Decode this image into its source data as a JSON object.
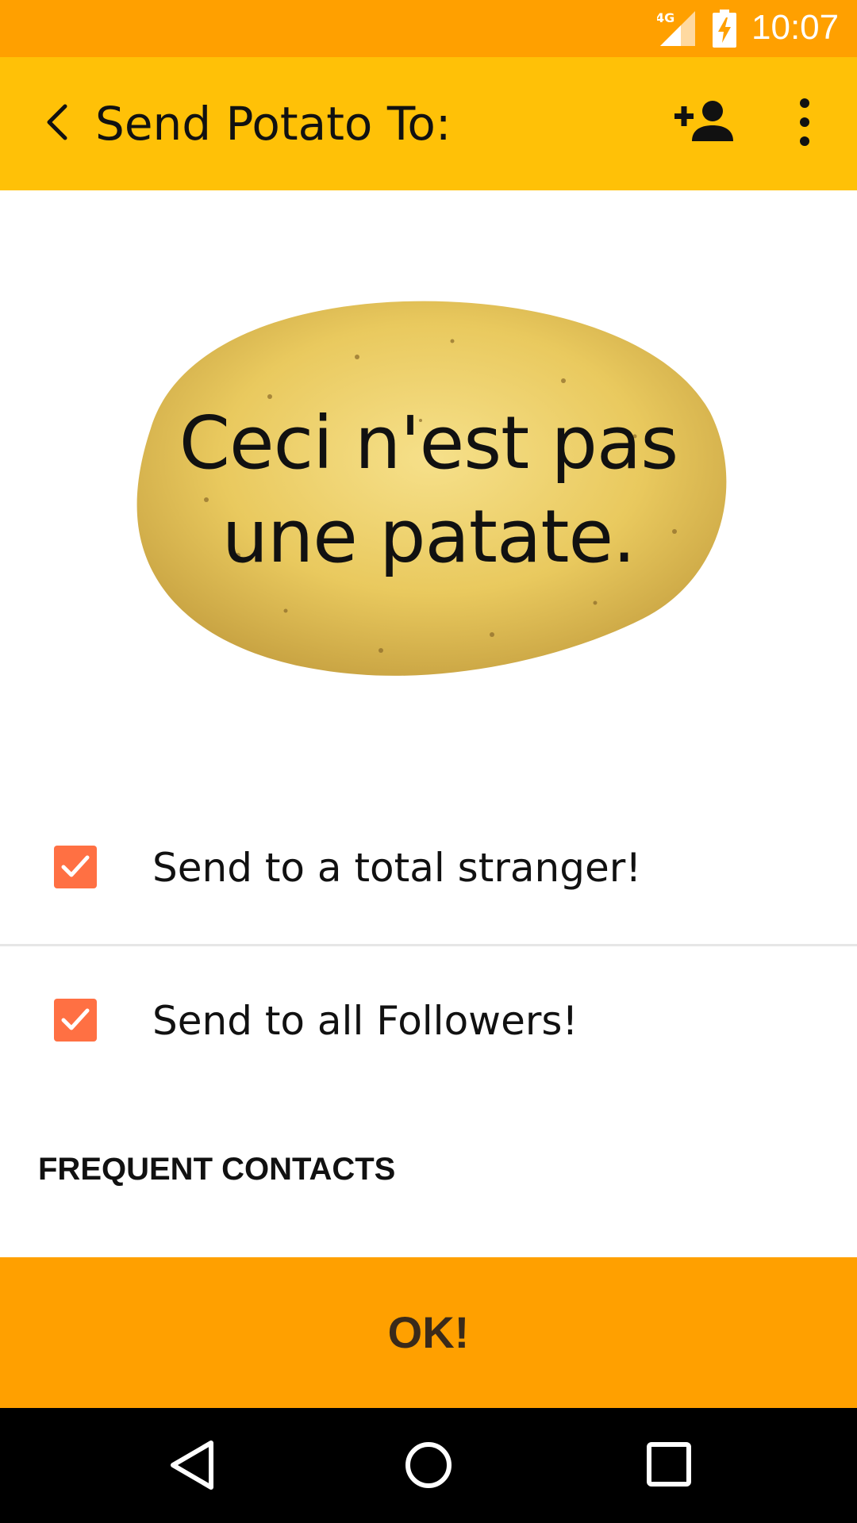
{
  "status_bar": {
    "network": "4G",
    "time": "10:07",
    "icons": [
      "signal-icon",
      "battery-charging-icon"
    ],
    "color": "#FFA000"
  },
  "app_bar": {
    "title": "Send Potato To:",
    "back_icon": "chevron-left-icon",
    "add_contact_icon": "person-add-icon",
    "overflow_icon": "more-vert-icon",
    "color": "#FFC107"
  },
  "potato": {
    "message_line1": "Ceci n'est pas",
    "message_line2": "une patate."
  },
  "options": [
    {
      "label": "Send to a total stranger!",
      "checked": true
    },
    {
      "label": "Send to all Followers!",
      "checked": true
    }
  ],
  "checkbox_color": "#FF7043",
  "section": {
    "title": "FREQUENT CONTACTS"
  },
  "ok_button": {
    "label": "OK!",
    "color": "#FFA000"
  },
  "nav_bar": {
    "icons": [
      "back-triangle-icon",
      "home-circle-icon",
      "recents-square-icon"
    ]
  }
}
